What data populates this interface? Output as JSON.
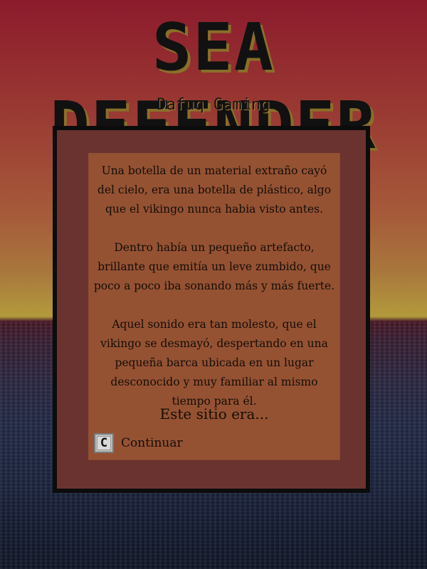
{
  "game": {
    "title": "SEA DEFENDER",
    "studio": "Dafuq Gaming"
  },
  "dialog": {
    "paragraphs": [
      "Una botella de un material extraño cayó del cielo, era una botella de plástico, algo que el vikingo nunca habia visto antes.",
      "Dentro había un pequeño artefacto, brillante que emitía un leve zumbido, que poco a poco iba sonando más y más fuerte.",
      "Aquel sonido era tan molesto, que el vikingo se desmayó, despertando en una pequeña barca ubicada en un lugar desconocido y muy familiar al mismo tiempo para él."
    ],
    "ending": "Este sitio era...",
    "continue_key": "C",
    "continue_label": "Continuar"
  },
  "colors": {
    "frame_border": "#0c0c0c",
    "frame_fill": "#6a3330",
    "panel_fill": "#955233",
    "text": "#140d08"
  }
}
